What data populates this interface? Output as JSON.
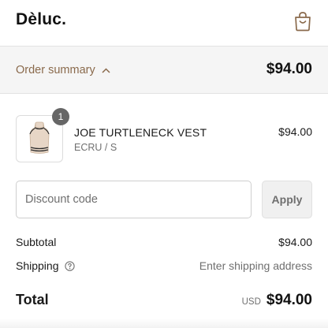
{
  "header": {
    "brand": "Dèluc.",
    "cart_icon": "shopping-bag-icon"
  },
  "summary": {
    "toggle_label": "Order summary",
    "toggle_icon": "chevron-up-icon",
    "total": "$94.00"
  },
  "line_items": [
    {
      "quantity": "1",
      "name": "JOE TURTLENECK VEST",
      "variant": "ECRU / S",
      "price": "$94.00"
    }
  ],
  "discount": {
    "placeholder": "Discount code",
    "value": "",
    "apply_label": "Apply"
  },
  "totals": {
    "subtotal_label": "Subtotal",
    "subtotal_value": "$94.00",
    "shipping_label": "Shipping",
    "shipping_help_icon": "question-circle-icon",
    "shipping_value": "Enter shipping address",
    "total_label": "Total",
    "currency": "USD",
    "total_value": "$94.00"
  },
  "colors": {
    "accent": "#8a6a4c",
    "summary_bg": "#f5f5f5",
    "badge": "#666666"
  }
}
